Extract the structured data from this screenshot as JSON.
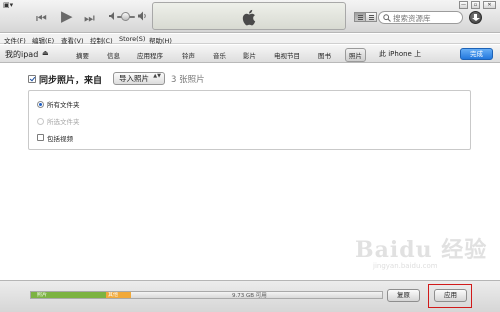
{
  "window": {
    "menu_glyph": "▣▾",
    "controls": [
      "—",
      "▫",
      "✕"
    ]
  },
  "player": {
    "rewind_icon": "⏮",
    "play_icon": "▶",
    "forward_icon": "⏭",
    "search_placeholder": "搜索资源库",
    "view_modes": [
      "list",
      "grid",
      "coverflow"
    ]
  },
  "menubar": {
    "items": [
      "文件(F)",
      "编辑(E)",
      "查看(V)",
      "控制(C)",
      "Store(S)",
      "帮助(H)"
    ]
  },
  "device": {
    "name": "我的ipad",
    "eject_icon": "⏏"
  },
  "tabs": [
    "摘要",
    "信息",
    "应用程序",
    "铃声",
    "音乐",
    "影片",
    "电视节目",
    "图书",
    "照片",
    "此 iPhone 上"
  ],
  "selected_tab": "照片",
  "done_label": "完成",
  "sync": {
    "label": "同步照片，来自",
    "checked": true,
    "source_value": "导入照片",
    "source_chevron": "▲▼",
    "count_text": "3 张照片"
  },
  "options": {
    "all_folders": "所有文件夹",
    "selected_folders": "所选文件夹",
    "include_videos": "包括视频"
  },
  "capacity": {
    "segments": [
      {
        "name": "照片",
        "label": "照片",
        "color": "#7cb342",
        "fraction": 0.215
      },
      {
        "name": "其他",
        "label": "其他",
        "color": "#f1a93a",
        "fraction": 0.07
      }
    ],
    "free_text": "9.73 GB 可用"
  },
  "buttons": {
    "revert": "复原",
    "apply": "应用"
  },
  "watermark": {
    "main": "Baidu 经验",
    "sub": "jingyan.baidu.com"
  },
  "colors": {
    "accent_blue": "#2378dd",
    "highlight_red": "#d11a1a",
    "photos_green": "#7cb342",
    "other_orange": "#f1a93a"
  }
}
